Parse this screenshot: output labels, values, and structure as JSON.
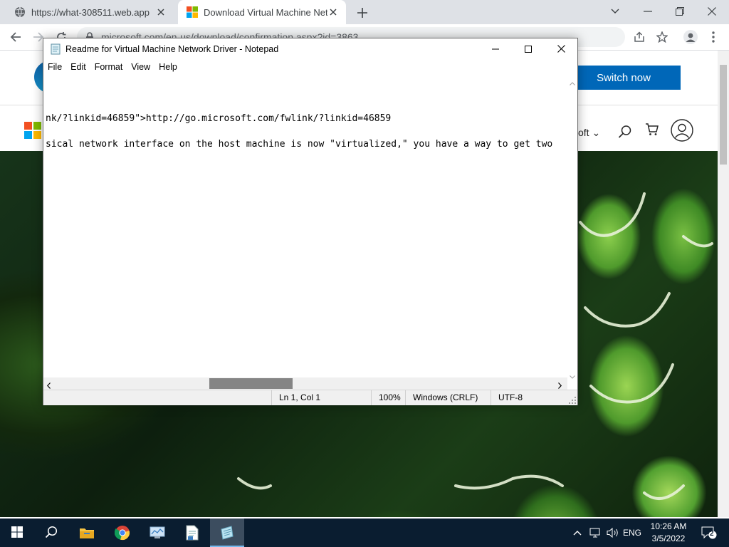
{
  "browser": {
    "tabs": [
      {
        "title": "https://what-308511.web.app",
        "favicon": "globe-icon"
      },
      {
        "title": "Download Virtual Machine Netw",
        "favicon": "windows-logo-icon",
        "active": true
      }
    ],
    "url": "microsoft.com/en-us/download/confirmation.aspx?id=3863"
  },
  "webpage": {
    "switch_button": "Switch now",
    "nav_microsoft": "oft ⌄"
  },
  "notepad": {
    "title": "Readme for Virtual Machine Network Driver - Notepad",
    "menu": [
      "File",
      "Edit",
      "Format",
      "View",
      "Help"
    ],
    "lines": [
      "nk/?linkid=46859\">http://go.microsoft.com/fwlink/?linkid=46859",
      "sical network interface on the host machine is now \"virtualized,\" you have a way to get two"
    ],
    "status": {
      "position": "Ln 1, Col 1",
      "zoom": "100%",
      "line_ending": "Windows (CRLF)",
      "encoding": "UTF-8"
    }
  },
  "taskbar": {
    "language": "ENG",
    "time": "10:26 AM",
    "date": "3/5/2022",
    "notification_count": "2",
    "apps": [
      "file-explorer-icon",
      "chrome-icon",
      "control-panel-icon",
      "notepad-doc-icon",
      "notepad-icon"
    ]
  }
}
